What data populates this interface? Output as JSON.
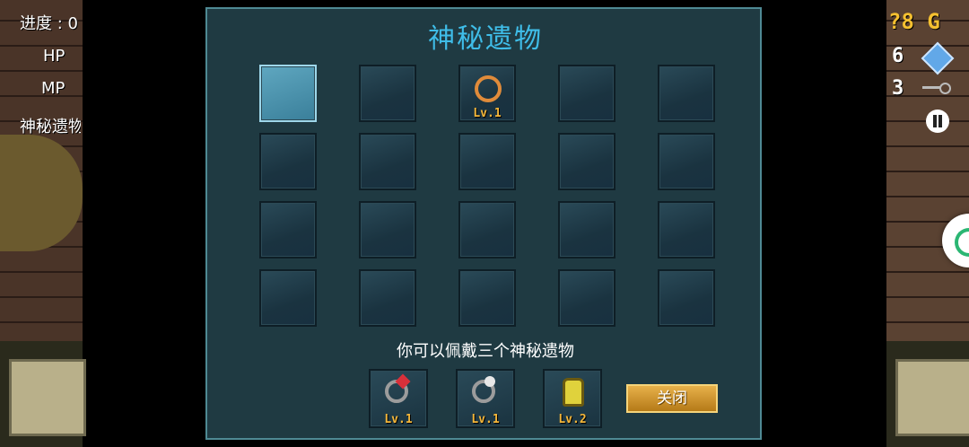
{
  "hud": {
    "progress_label": "进度 : 0",
    "hp_label": "HP",
    "mp_label": "MP",
    "relic_label": "神秘遗物",
    "gold_value": "?8 G",
    "gem_count": "6",
    "key_count": "3"
  },
  "dialog": {
    "title": "神秘遗物",
    "hint": "你可以佩戴三个神秘遗物",
    "close_label": "关闭",
    "grid": {
      "rows": 4,
      "cols": 5,
      "selected_slot": 0,
      "items": [
        {
          "slot": 2,
          "icon": "amulet-icon",
          "level": "Lv.1"
        }
      ]
    },
    "equipped": [
      {
        "icon": "red-gem-ring-icon",
        "level": "Lv.1",
        "color": "#d8303a"
      },
      {
        "icon": "skull-ring-icon",
        "level": "Lv.1",
        "color": "#e8e8e8"
      },
      {
        "icon": "lantern-icon",
        "level": "Lv.2",
        "color": "#e0d23c"
      }
    ]
  }
}
